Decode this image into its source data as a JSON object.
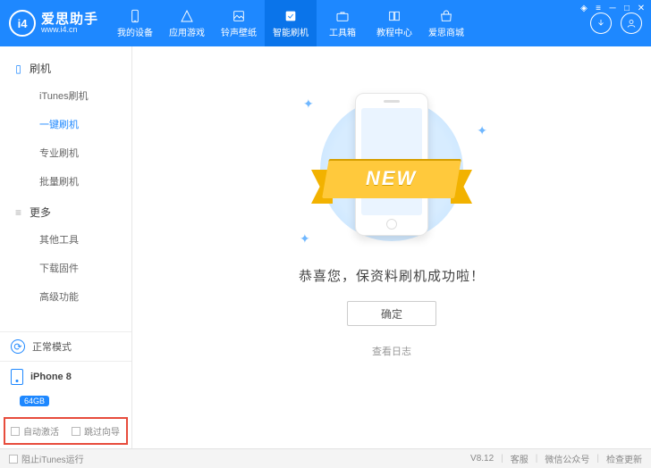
{
  "brand": {
    "logo_text": "i4",
    "title": "爱思助手",
    "url": "www.i4.cn"
  },
  "nav": {
    "items": [
      {
        "key": "device",
        "label": "我的设备"
      },
      {
        "key": "apps",
        "label": "应用游戏"
      },
      {
        "key": "ring",
        "label": "铃声壁纸"
      },
      {
        "key": "flash",
        "label": "智能刷机"
      },
      {
        "key": "toolbox",
        "label": "工具箱"
      },
      {
        "key": "tutorial",
        "label": "教程中心"
      },
      {
        "key": "store",
        "label": "爱思商城"
      }
    ],
    "active": "flash"
  },
  "sidebar": {
    "groups": [
      {
        "title": "刷机",
        "items": [
          "iTunes刷机",
          "一键刷机",
          "专业刷机",
          "批量刷机"
        ],
        "active_index": 1
      },
      {
        "title": "更多",
        "items": [
          "其他工具",
          "下载固件",
          "高级功能"
        ],
        "active_index": -1
      }
    ],
    "mode_label": "正常模式",
    "device_name": "iPhone 8",
    "device_badge": "64GB",
    "checks": {
      "auto_activate": "自动激活",
      "skip_guide": "跳过向导"
    }
  },
  "main": {
    "ribbon_text": "NEW",
    "message": "恭喜您，保资料刷机成功啦！",
    "ok_button": "确定",
    "log_link": "查看日志"
  },
  "footer": {
    "block_itunes": "阻止iTunes运行",
    "version": "V8.12",
    "links": [
      "客服",
      "微信公众号",
      "检查更新"
    ]
  }
}
